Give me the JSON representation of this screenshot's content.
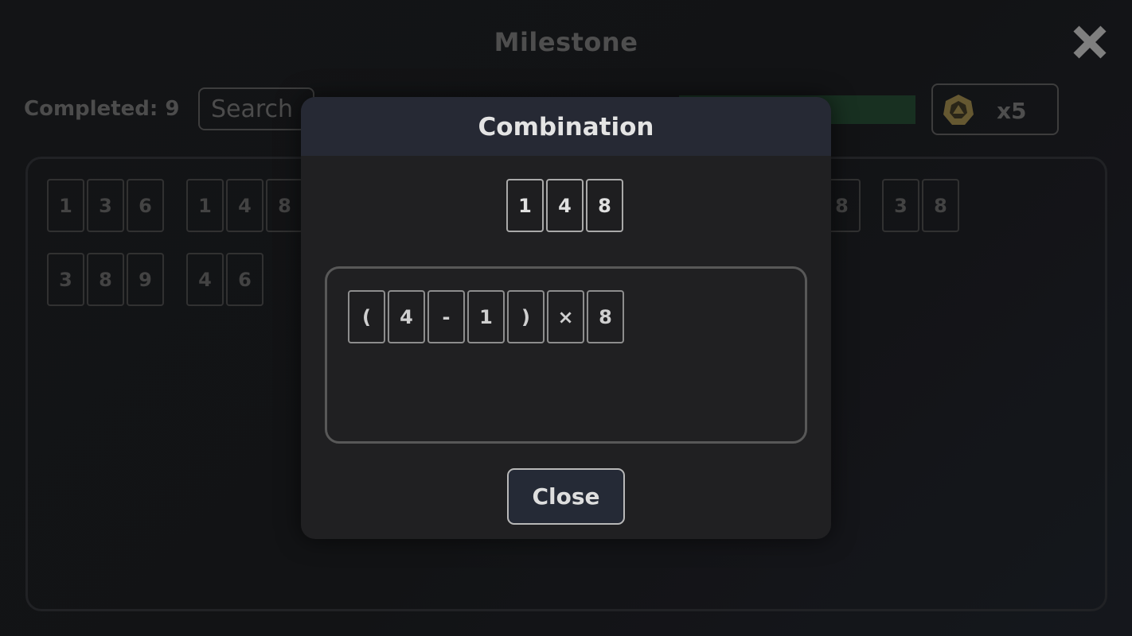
{
  "header": {
    "title": "Milestone"
  },
  "toolbar": {
    "completed_label": "Completed: 9",
    "search_placeholder": "Search",
    "progress_fraction": 1.0,
    "hint_count": "x5"
  },
  "colors": {
    "progress_green": "#22432f",
    "hint_gold": "#8c7a45",
    "modal_header": "#262934"
  },
  "icons": {
    "close": "close-x-icon",
    "hint": "hint-coin-icon"
  },
  "combinations": [
    [
      "1",
      "3",
      "6"
    ],
    [
      "1",
      "4",
      "8"
    ],
    [
      "8"
    ],
    [
      "3",
      "8"
    ],
    [
      "3",
      "8",
      "9"
    ],
    [
      "4",
      "6"
    ]
  ],
  "modal": {
    "title": "Combination",
    "numbers": [
      "1",
      "4",
      "8"
    ],
    "expression": [
      "(",
      "4",
      "-",
      "1",
      ")",
      "×",
      "8"
    ],
    "close_label": "Close"
  }
}
